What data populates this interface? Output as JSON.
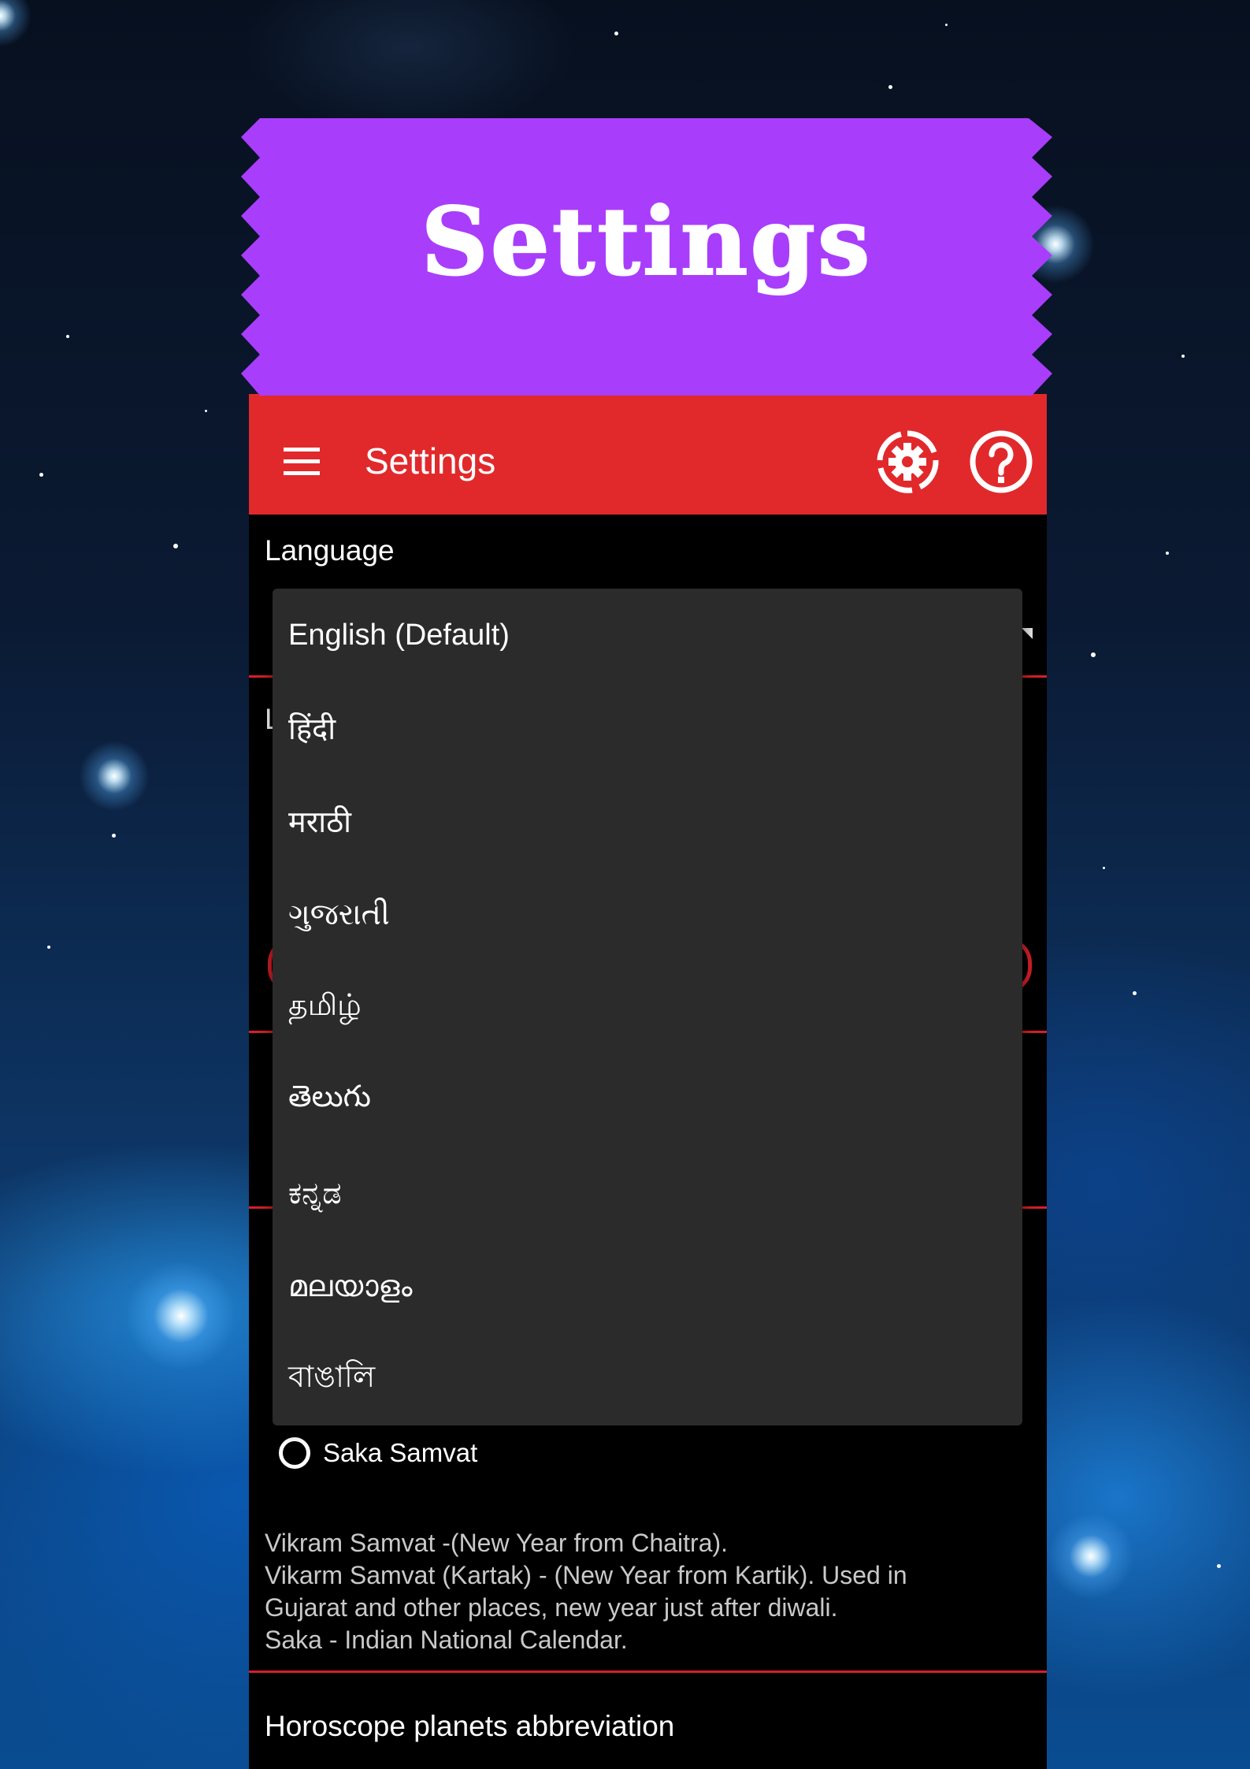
{
  "banner": {
    "title": "Settings"
  },
  "appbar": {
    "title": "Settings",
    "background": "#e1292c",
    "icons": [
      "menu-icon",
      "gear-icon",
      "help-icon"
    ]
  },
  "preferences": {
    "language_label": "Language",
    "language_selected": "English (Default)",
    "calendar_options_visible": [
      "Saka Samvat"
    ],
    "calendar_description": [
      "Vikram Samvat -(New Year from Chaitra).",
      "Vikarm Samvat (Kartak) - (New Year from Kartik). Used in",
      "Gujarat and other places, new year just after diwali.",
      "Saka - Indian National Calendar."
    ],
    "horoscope_label": "Horoscope planets abbreviation"
  },
  "language_dropdown": {
    "options": [
      "English (Default)",
      "हिंदी",
      "मराठी",
      "ગુજરાતી",
      "தமிழ்",
      "తెలుగు",
      "ಕನ್ನಡ",
      "മലയാളം",
      "বাঙালি"
    ]
  },
  "colors": {
    "banner": "#a93dfc",
    "accent_red": "#d61f26",
    "dropdown_bg": "#2b2b2b",
    "page_bg": "#000000"
  }
}
